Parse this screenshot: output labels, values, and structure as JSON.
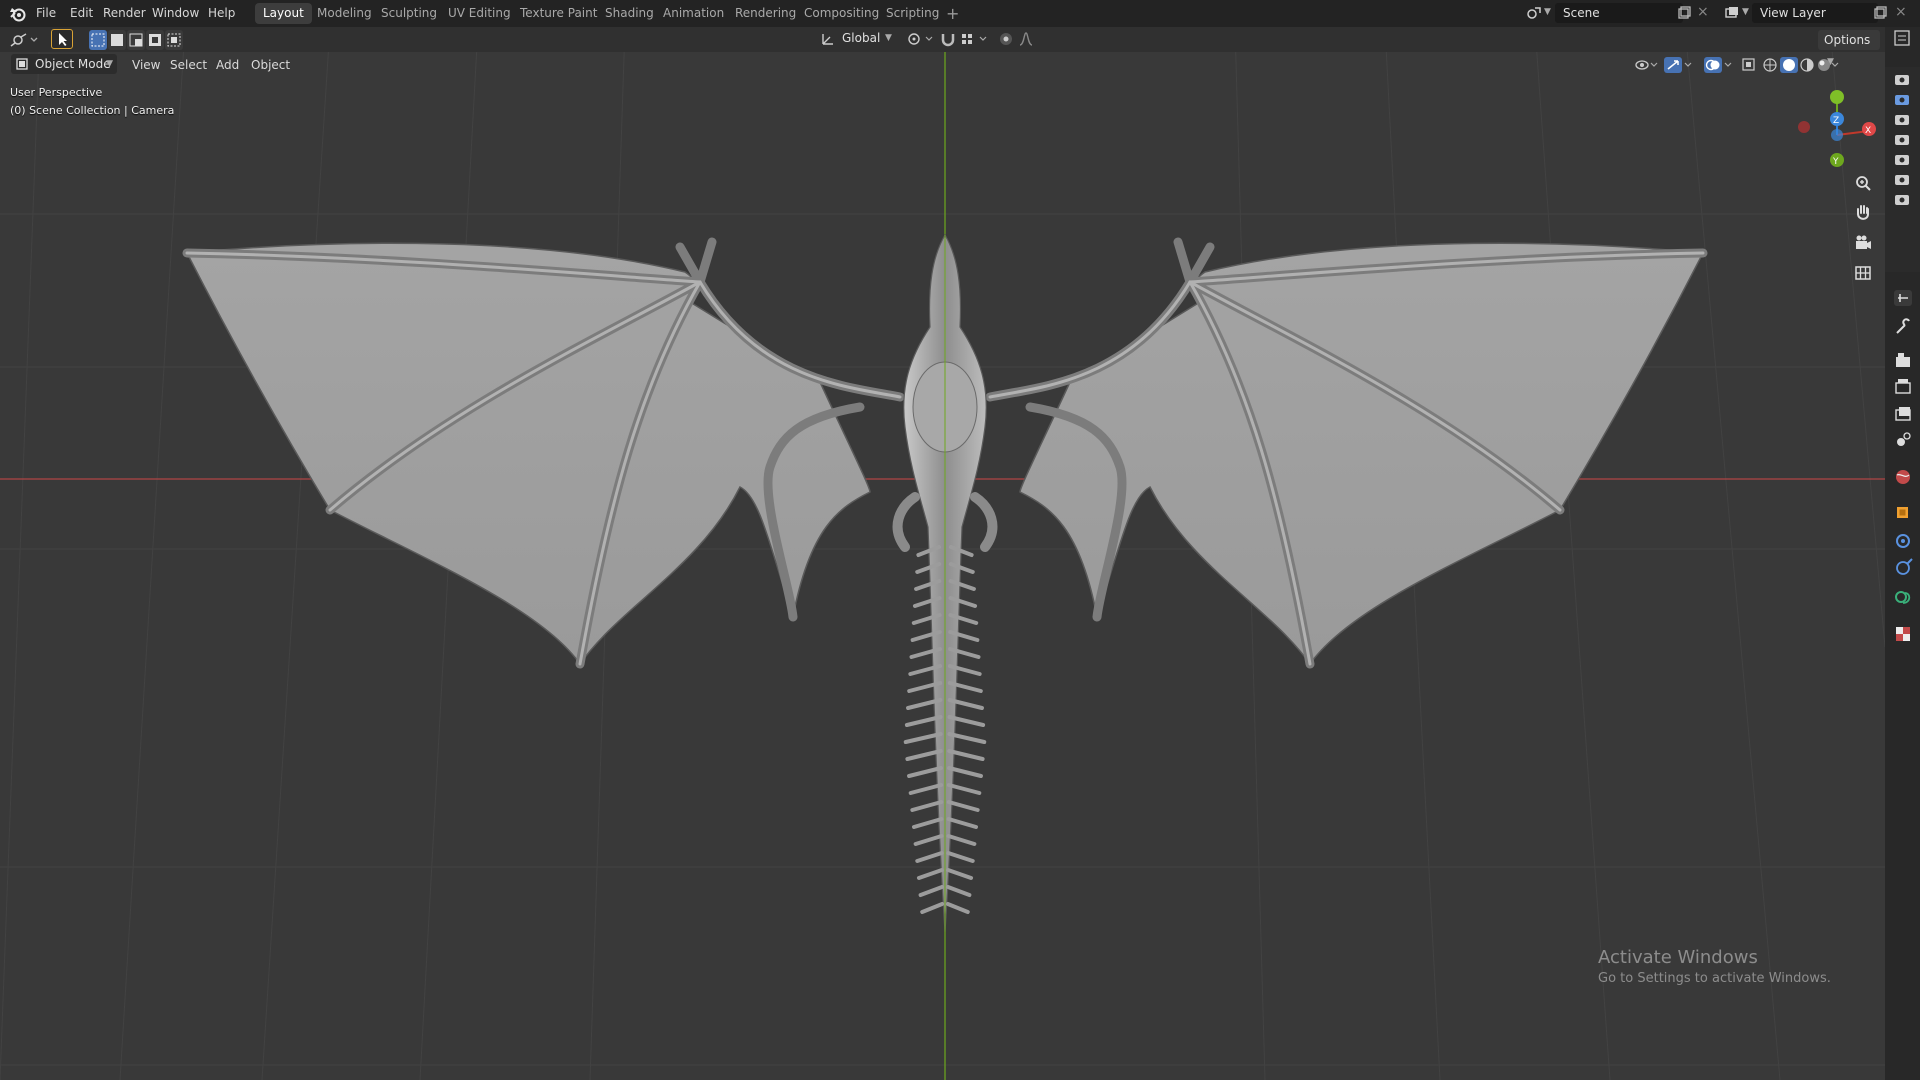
{
  "menu": [
    "File",
    "Edit",
    "Render",
    "Window",
    "Help"
  ],
  "workspaces": [
    {
      "label": "Layout",
      "active": true
    },
    {
      "label": "Modeling",
      "active": false
    },
    {
      "label": "Sculpting",
      "active": false
    },
    {
      "label": "UV Editing",
      "active": false
    },
    {
      "label": "Texture Paint",
      "active": false
    },
    {
      "label": "Shading",
      "active": false
    },
    {
      "label": "Animation",
      "active": false
    },
    {
      "label": "Rendering",
      "active": false
    },
    {
      "label": "Compositing",
      "active": false
    },
    {
      "label": "Scripting",
      "active": false
    }
  ],
  "scene_name": "Scene",
  "view_layer": "View Layer",
  "header": {
    "transform_orientation": "Global",
    "options_label": "Options"
  },
  "editor_header": {
    "mode": "Object Mode",
    "menus": [
      "View",
      "Select",
      "Add",
      "Object"
    ]
  },
  "viewport": {
    "perspective_label": "User Perspective",
    "collection_label": "(0) Scene Collection | Camera"
  },
  "gizmo_axes": {
    "x": "X",
    "y": "Y",
    "z": "Z"
  },
  "watermark": {
    "title": "Activate Windows",
    "subtitle": "Go to Settings to activate Windows."
  },
  "colors": {
    "accent": "#4772b3",
    "x_axis": "#c0392b",
    "y_axis": "#6ea81e",
    "z_axis": "#2e7dd6",
    "active_object": "#f0a030"
  }
}
